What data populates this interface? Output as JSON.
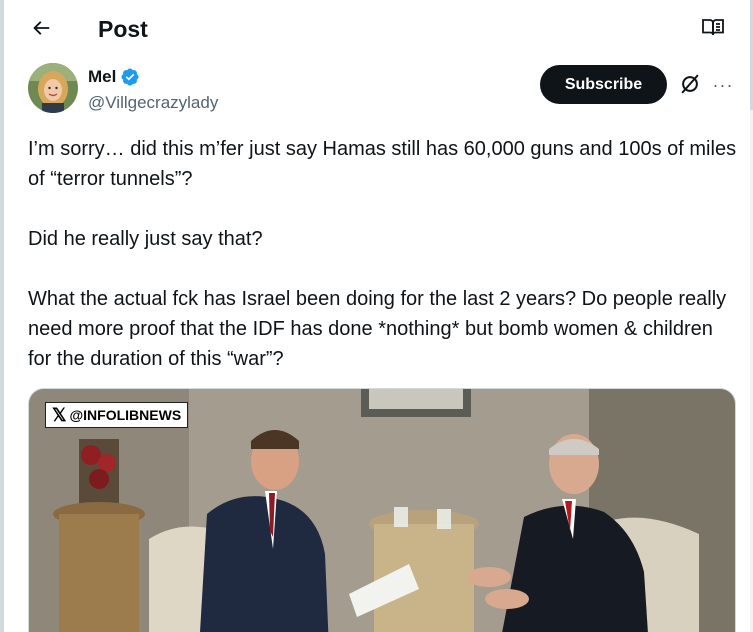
{
  "header": {
    "title": "Post",
    "back_icon": "arrow-left-icon",
    "reader_icon": "book-open-icon"
  },
  "author": {
    "name": "Mel",
    "handle": "@Villgecrazylady",
    "verified": true,
    "verified_color": "#1d9bf0"
  },
  "actions": {
    "subscribe_label": "Subscribe",
    "grok_icon": "grok-icon",
    "more_icon": "more-horizontal-icon",
    "more_glyph": "···"
  },
  "post": {
    "paragraphs": [
      "I’m sorry… did this m’fer just say Hamas still has 60,000 guns and 100s of miles of “terror tunnels”?",
      "Did he really just say that?",
      "What the actual fck has Israel been doing for the last 2 years? Do people really need more proof that the IDF has done *nothing* but bomb women & children for the duration of this “war”?"
    ]
  },
  "media": {
    "watermark": "@INFOLIBNEWS",
    "watermark_logo": "𝕏"
  },
  "colors": {
    "text": "#0f1419",
    "secondary": "#536471",
    "accent": "#1d9bf0",
    "button_dark": "#0f1419"
  }
}
